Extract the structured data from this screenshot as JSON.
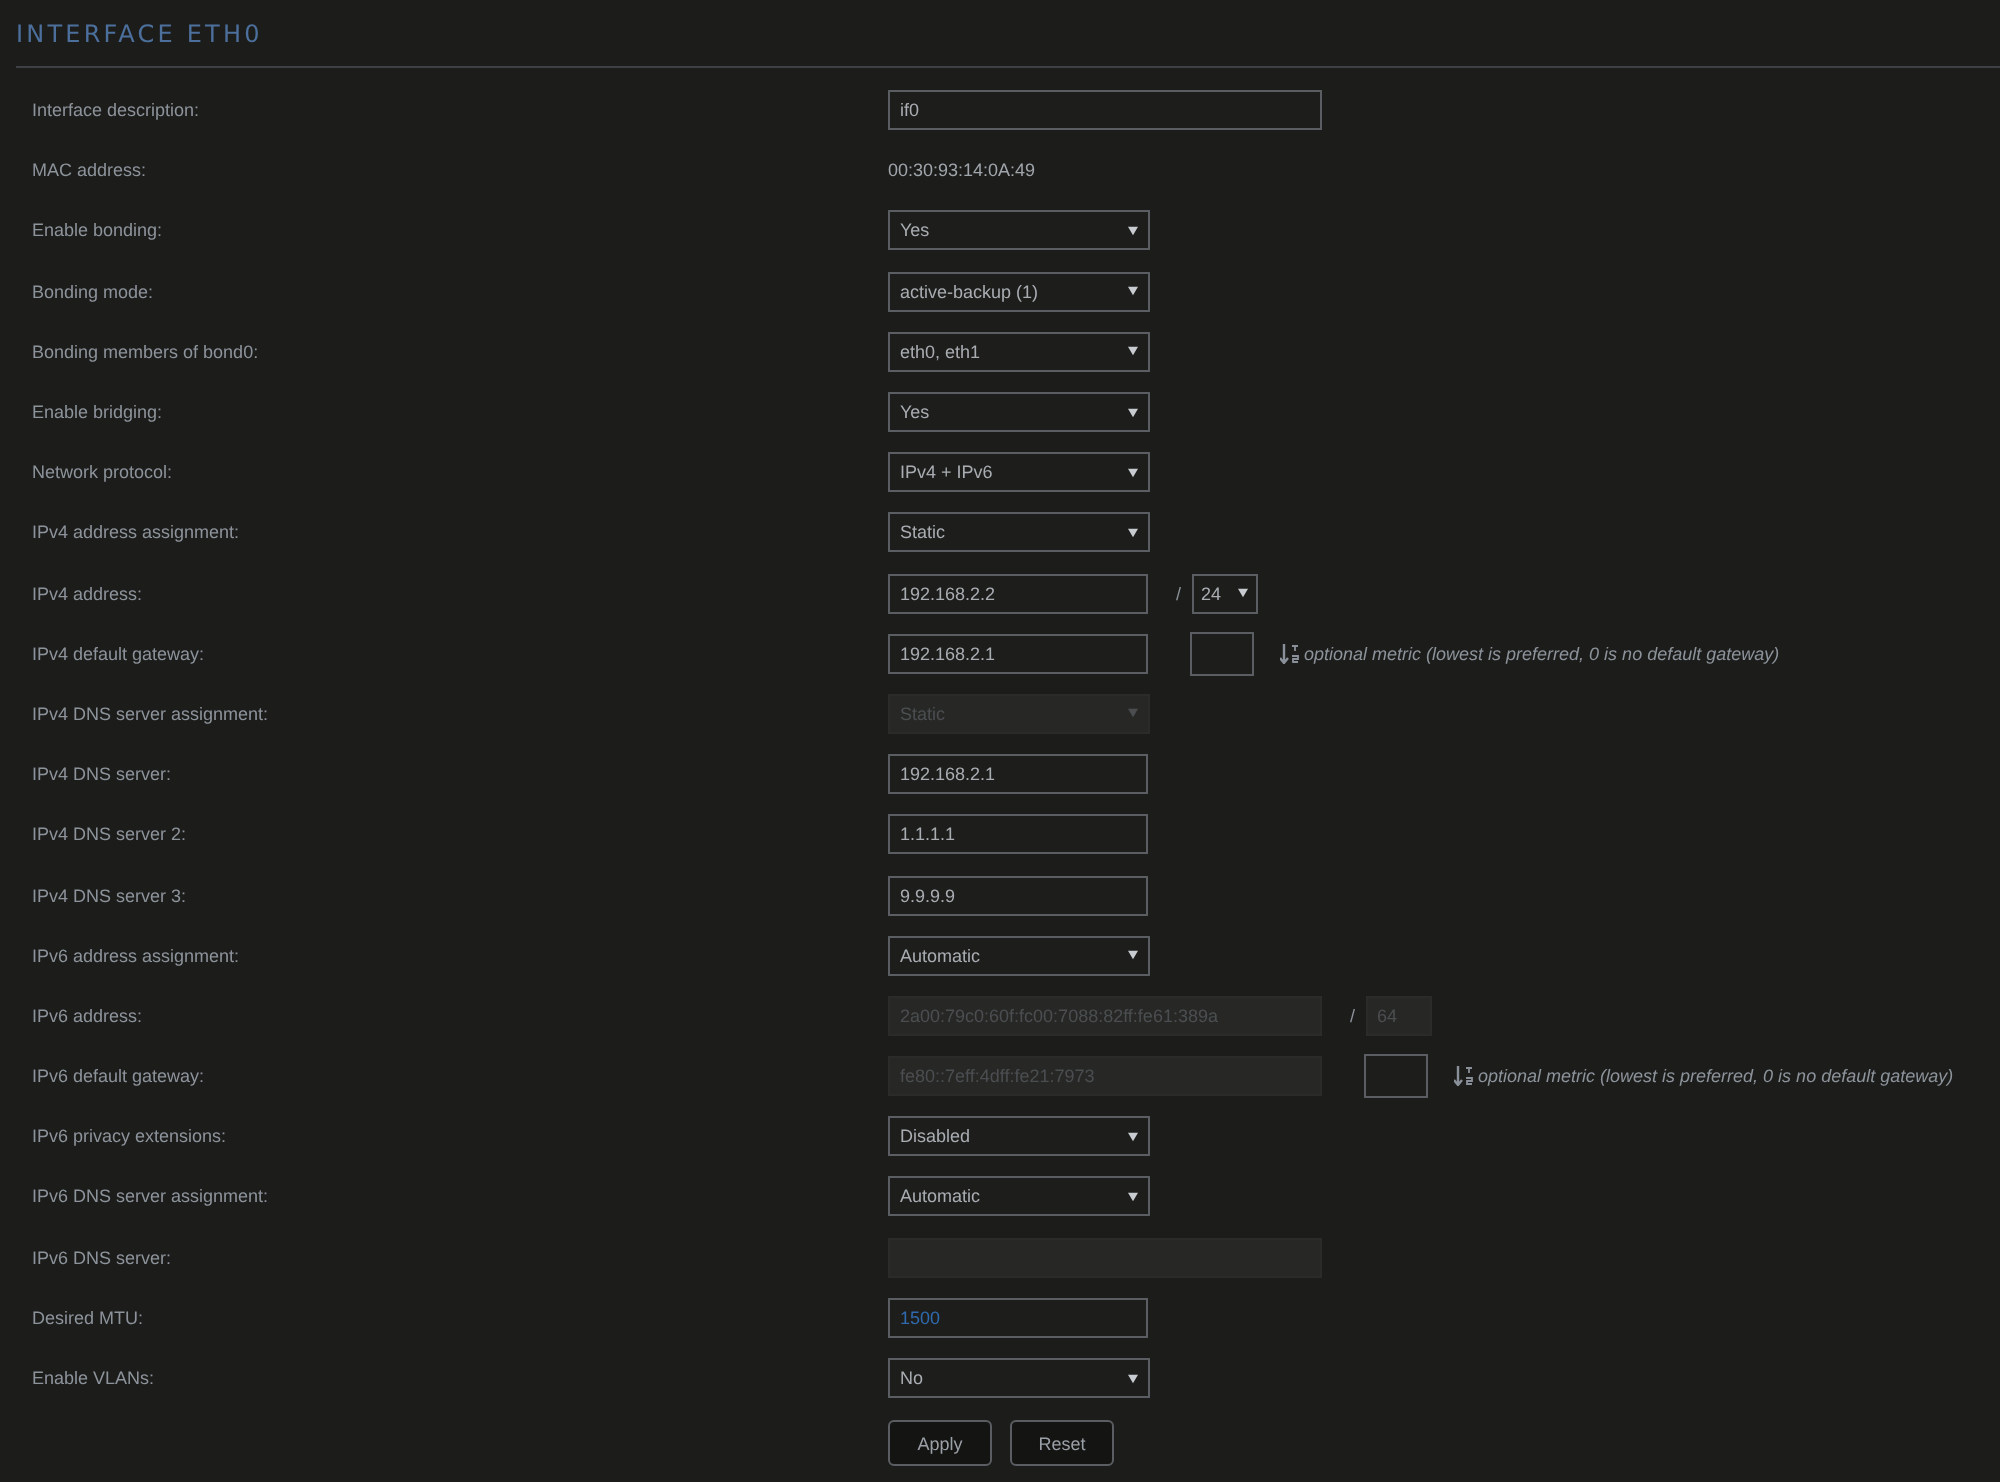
{
  "title": "INTERFACE ETH0",
  "rows": [
    {
      "label": "Interface description:",
      "field": {
        "kind": "input-wide",
        "value": "if0",
        "disabled": false
      }
    },
    {
      "label": "MAC address:",
      "field": {
        "kind": "static",
        "value": "00:30:93:14:0A:49"
      }
    },
    {
      "label": "Enable bonding:",
      "field": {
        "kind": "select",
        "value": "Yes",
        "disabled": false
      }
    },
    {
      "label": "Bonding mode:",
      "field": {
        "kind": "select",
        "value": "active-backup (1)",
        "disabled": false
      }
    },
    {
      "label": "Bonding members of bond0:",
      "field": {
        "kind": "select",
        "value": "eth0, eth1",
        "disabled": false
      }
    },
    {
      "label": "Enable bridging:",
      "field": {
        "kind": "select",
        "value": "Yes",
        "disabled": false
      }
    },
    {
      "label": "Network protocol:",
      "field": {
        "kind": "select",
        "value": "IPv4 + IPv6",
        "disabled": false
      }
    },
    {
      "label": "IPv4 address assignment:",
      "field": {
        "kind": "select",
        "value": "Static",
        "disabled": false
      }
    },
    {
      "label": "IPv4 address:",
      "field": {
        "kind": "input",
        "value": "192.168.2.2",
        "disabled": false
      },
      "suffix": {
        "separator": "/",
        "kind": "select",
        "value": "24",
        "disabled": false
      }
    },
    {
      "label": "IPv4 default gateway:",
      "field": {
        "kind": "input",
        "value": "192.168.2.1",
        "disabled": false
      },
      "metric": {
        "hint": "optional metric (lowest is preferred, 0 is no default gateway)"
      }
    },
    {
      "label": "IPv4 DNS server assignment:",
      "field": {
        "kind": "select",
        "value": "Static",
        "disabled": true
      }
    },
    {
      "label": "IPv4 DNS server:",
      "field": {
        "kind": "input",
        "value": "192.168.2.1",
        "disabled": false
      }
    },
    {
      "label": "IPv4 DNS server 2:",
      "field": {
        "kind": "input",
        "value": "1.1.1.1",
        "disabled": false
      }
    },
    {
      "label": "IPv4 DNS server 3:",
      "field": {
        "kind": "input",
        "value": "9.9.9.9",
        "disabled": false
      }
    },
    {
      "label": "IPv6 address assignment:",
      "field": {
        "kind": "select",
        "value": "Automatic",
        "disabled": false
      }
    },
    {
      "label": "IPv6 address:",
      "field": {
        "kind": "input-wide",
        "value": "2a00:79c0:60f:fc00:7088:82ff:fe61:389a",
        "disabled": true
      },
      "suffix": {
        "separator": "/",
        "kind": "input",
        "value": "64",
        "disabled": true
      }
    },
    {
      "label": "IPv6 default gateway:",
      "field": {
        "kind": "input-wide",
        "value": "fe80::7eff:4dff:fe21:7973",
        "disabled": true
      },
      "metric": {
        "hint": "optional metric (lowest is preferred, 0 is no default gateway)"
      }
    },
    {
      "label": "IPv6 privacy extensions:",
      "field": {
        "kind": "select",
        "value": "Disabled",
        "disabled": false
      }
    },
    {
      "label": "IPv6 DNS server assignment:",
      "field": {
        "kind": "select",
        "value": "Automatic",
        "disabled": false
      }
    },
    {
      "label": "IPv6 DNS server:",
      "field": {
        "kind": "input-wide",
        "disabled": true
      }
    },
    {
      "label": "Desired MTU:",
      "field": {
        "kind": "input",
        "value": "1500",
        "disabled": false,
        "modified": true
      }
    },
    {
      "label": "Enable VLANs:",
      "field": {
        "kind": "select",
        "value": "No",
        "disabled": false
      }
    }
  ],
  "buttons": [
    "Apply",
    "Reset"
  ]
}
